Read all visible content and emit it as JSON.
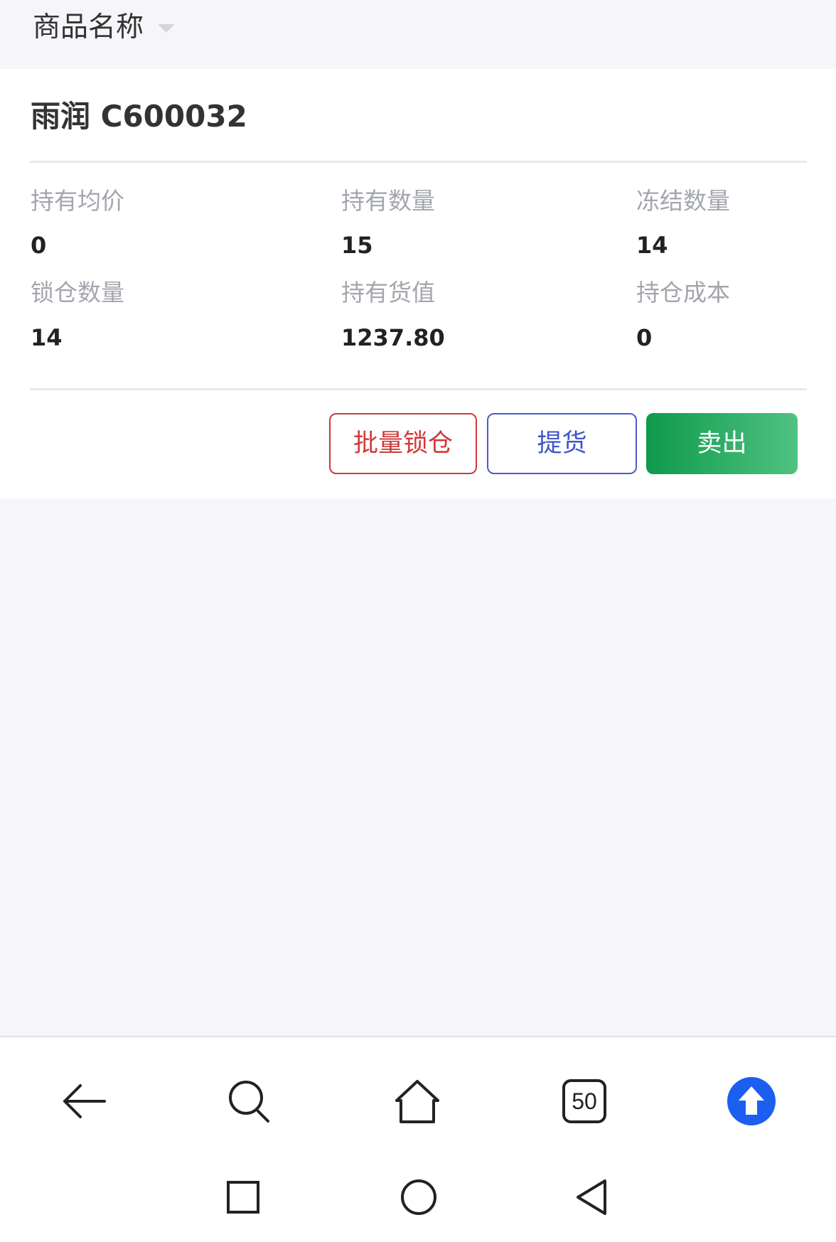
{
  "filter": {
    "label": "商品名称",
    "dropdown_icon": "caret-down-icon"
  },
  "product": {
    "title": "雨润 C600032"
  },
  "stats": {
    "avg_price": {
      "label": "持有均价",
      "value": "0"
    },
    "hold_qty": {
      "label": "持有数量",
      "value": "15"
    },
    "frozen_qty": {
      "label": "冻结数量",
      "value": "14"
    },
    "locked_qty": {
      "label": "锁仓数量",
      "value": "14"
    },
    "hold_value": {
      "label": "持有货值",
      "value": "1237.80"
    },
    "position_cost": {
      "label": "持仓成本",
      "value": "0"
    }
  },
  "actions": {
    "batch_lock": "批量锁仓",
    "pickup": "提货",
    "sell": "卖出"
  },
  "browser_toolbar": {
    "tab_count": "50",
    "icons": [
      "back-arrow-icon",
      "search-icon",
      "home-icon",
      "tabs-icon",
      "upload-icon"
    ]
  },
  "colors": {
    "lock_red": "#cf3a3a",
    "pickup_blue": "#3e54c8",
    "sell_green_start": "#0e9a4c",
    "sell_green_end": "#50c281",
    "upload_blue": "#1a5ff0"
  }
}
